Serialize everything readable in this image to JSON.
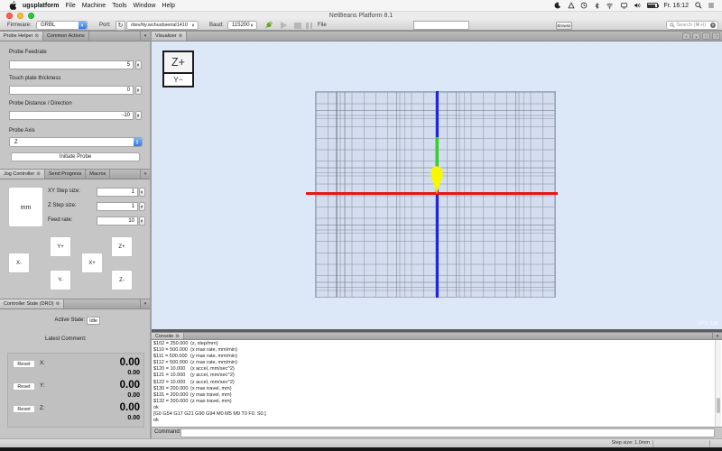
{
  "menubar": {
    "app": "ugsplatform",
    "items": [
      "File",
      "Machine",
      "Tools",
      "Window",
      "Help"
    ],
    "time": "Fr. 16:12",
    "icons": [
      "moon-icon",
      "airdrop-icon",
      "clock-icon",
      "bluetooth-icon",
      "wifi-icon",
      "display-icon",
      "volume-icon",
      "battery-icon",
      "spotlight-icon",
      "notification-center-icon"
    ]
  },
  "titlebar": {
    "title": "NetBeans Platform 8.1"
  },
  "toolbar": {
    "firmware_label": "Firmware:",
    "firmware_value": "GRBL",
    "port_label": "Port:",
    "refresh_glyph": "↻",
    "port_value": "/dev/tty.wchusbserial1410",
    "baud_label": "Baud:",
    "baud_value": "115200",
    "file_label": "File",
    "file_value": "",
    "browse_label": "Browse",
    "search_placeholder": "Search (⌘+I)"
  },
  "probe": {
    "tab": "Probe Helper",
    "tab2": "Common Actions",
    "feedrate_label": "Probe Feedrate",
    "feedrate_value": "5",
    "plate_label": "Touch plate thickness",
    "plate_value": "0",
    "distance_label": "Probe Distance / Direction",
    "distance_value": "-10",
    "axis_label": "Probe Axis",
    "axis_value": "Z",
    "initiate_label": "Initiate Probe"
  },
  "jog": {
    "tab": "Jog Controller",
    "tab2": "Send Progress",
    "tab3": "Macros",
    "units": "mm",
    "xy_label": "XY Step size:",
    "xy_value": "1",
    "z_label": "Z Step size:",
    "z_value": "1",
    "feed_label": "Feed rate:",
    "feed_value": "10",
    "btn_yplus": "Y+",
    "btn_zplus": "Z+",
    "btn_xminus": "X-",
    "btn_xplus": "X+",
    "btn_yminus": "Y-",
    "btn_zminus": "Z-"
  },
  "state": {
    "tab": "Controller State (DRO)",
    "active_label": "Active State:",
    "active_value": "Idle",
    "comment_label": "Latest Comment:",
    "reset_label": "Reset",
    "axes": [
      {
        "label": "X:",
        "value": "0.00",
        "sub": "0.00"
      },
      {
        "label": "Y:",
        "value": "0.00",
        "sub": "0.00"
      },
      {
        "label": "Z:",
        "value": "0.00",
        "sub": "0.00"
      }
    ]
  },
  "visualizer": {
    "tab": "Visualizer",
    "zplus": "Z+",
    "yminus": "Y−",
    "fps": "FPS: 131",
    "colors": {
      "background": "#dce8f8",
      "grid_bg": "#d3ddee",
      "x_axis_red": "#e81616",
      "y_axis_blue": "#2023e8",
      "tool_green": "#2fd12f",
      "arrow_yellow": "#f7f700"
    }
  },
  "console": {
    "tab": "Console",
    "lines": [
      {
        "a": "$102 = 250.000",
        "b": "(z, step/mm)"
      },
      {
        "a": "$110 = 500.000",
        "b": "(x max rate, mm/min)"
      },
      {
        "a": "$111 = 500.000",
        "b": "(y max rate, mm/min)"
      },
      {
        "a": "$112 = 500.000",
        "b": "(z max rate, mm/min)"
      },
      {
        "a": "$120 = 10.000",
        "b": "(x accel, mm/sec^2)"
      },
      {
        "a": "$121 = 10.000",
        "b": "(y accel, mm/sec^2)"
      },
      {
        "a": "$122 = 10.000",
        "b": "(z accel, mm/sec^2)"
      },
      {
        "a": "$130 = 200.000",
        "b": "(x max travel, mm)"
      },
      {
        "a": "$131 = 200.000",
        "b": "(y max travel, mm)"
      },
      {
        "a": "$132 = 200.000",
        "b": "(z max travel, mm)"
      },
      {
        "a": "ok",
        "b": ""
      },
      {
        "a": "[G0 G54 G17 G21 G90 G94 M0 M5 M9 T0 F0. S0.]",
        "b": ""
      },
      {
        "a": "ok",
        "b": ""
      }
    ],
    "command_label": "Command:",
    "command_value": ""
  },
  "statusbar": {
    "step_label": "Step size: 1.0mm"
  }
}
